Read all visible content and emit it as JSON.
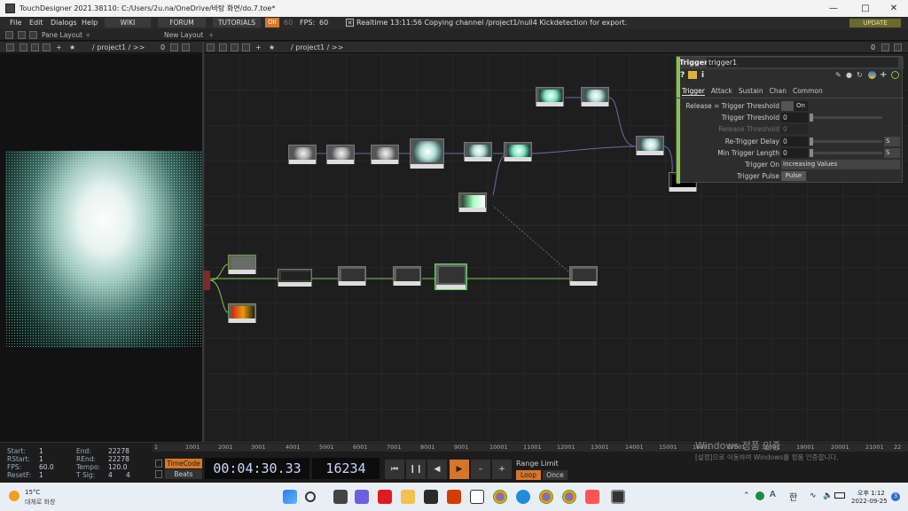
{
  "window": {
    "title": "TouchDesigner 2021.38110: C:/Users/2u.na/OneDrive/바탕 화면/do.7.toe*"
  },
  "menu": {
    "items": [
      "File",
      "Edit",
      "Dialogs",
      "Help"
    ],
    "wiki": "WIKI",
    "forum": "FORUM",
    "tutorials": "TUTORIALS",
    "oii": "OII",
    "fps_target": "60",
    "fps_label": "FPS:",
    "fps_value": "60",
    "realtime": "Realtime",
    "status": "13:11:56 Copying channel /project1/null4 Kickdetection for export.",
    "update": "UPDATE"
  },
  "panebar": {
    "pane_layout": "Pane Layout",
    "new_layout": "New Layout"
  },
  "left_path": {
    "path": "/ project1 / >>",
    "count": "0"
  },
  "right_path": {
    "path": "/ project1 / >>",
    "count": "0"
  },
  "params": {
    "op_type": "Trigger",
    "op_name": "trigger1",
    "tabs": [
      "Trigger",
      "Attack",
      "Sustain",
      "Chan",
      "Common"
    ],
    "rows": [
      {
        "label": "Release = Trigger Threshold",
        "value": "On"
      },
      {
        "label": "Trigger Threshold",
        "value": "0"
      },
      {
        "label": "Release Threshold",
        "value": "0"
      },
      {
        "label": "Re-Trigger Delay",
        "value": "0",
        "unit": "S"
      },
      {
        "label": "Min Trigger Length",
        "value": "0",
        "unit": "S"
      },
      {
        "label": "Trigger On",
        "value": "Increasing Values"
      },
      {
        "label": "Trigger Pulse",
        "value": "Pulse"
      }
    ]
  },
  "ruler": {
    "ticks": [
      "1",
      "1001",
      "2001",
      "3001",
      "4001",
      "5001",
      "6001",
      "7001",
      "8001",
      "9001",
      "10001",
      "11001",
      "12001",
      "13001",
      "14001",
      "15001",
      "16001",
      "17001",
      "18001",
      "19001",
      "20001",
      "21001",
      "22"
    ]
  },
  "timeline": {
    "start_label": "Start:",
    "start": "1",
    "end_label": "End:",
    "end": "22278",
    "rstart_label": "RStart:",
    "rstart": "1",
    "rend_label": "REnd:",
    "rend": "22278",
    "fps_label": "FPS:",
    "fps": "60.0",
    "tempo_label": "Tempo:",
    "tempo": "120.0",
    "resetf_label": "ResetF:",
    "resetf": "1",
    "tsig_label": "T Sig:",
    "tsig_a": "4",
    "tsig_b": "4",
    "timecode": "TimeCode",
    "beats": "Beats",
    "time": "00:04:30.33",
    "frame": "16234",
    "range_limit": "Range Limit",
    "loop": "Loop",
    "once": "Once"
  },
  "watermark": {
    "line1": "Windows 정품 인증",
    "line2": "[설정]으로 이동하여 Windows를 정품 인증합니다."
  },
  "taskbar": {
    "temp": "15°C",
    "weather": "대체로 화창",
    "time": "오후 1:12",
    "date": "2022-09-25",
    "notif": "3",
    "lang_a": "A",
    "lang_ko": "한"
  },
  "colors": {
    "accent_green": "#8bc34a",
    "orange": "#d6762a",
    "time_blue": "#c9d6ff"
  }
}
